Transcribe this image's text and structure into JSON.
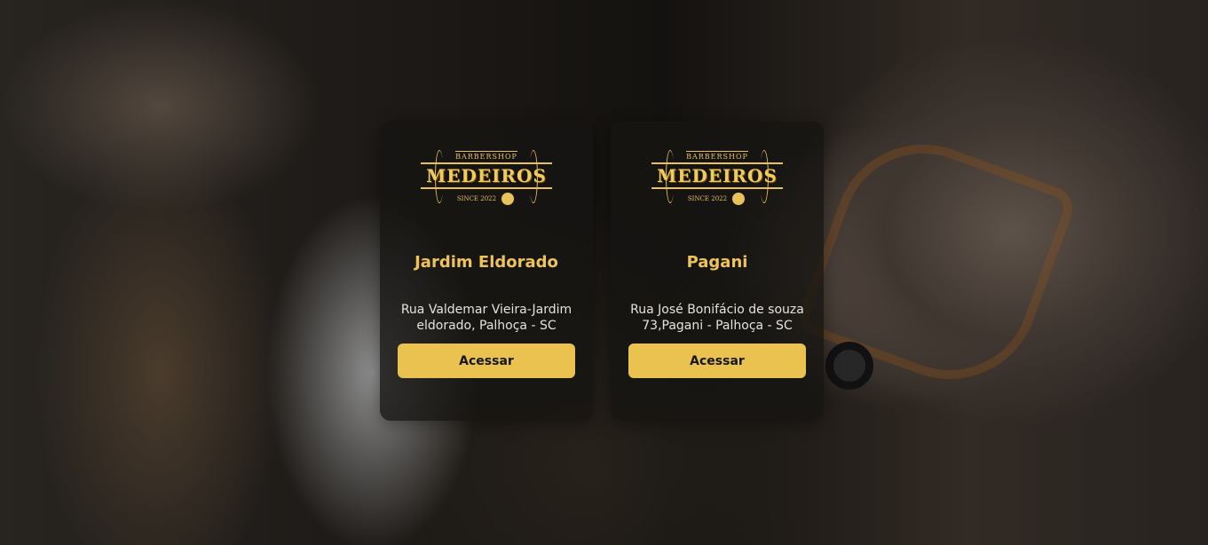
{
  "brand": {
    "logo_top": "BARBERSHOP",
    "logo_name": "MEDEIROS",
    "logo_since": "SINCE 2022"
  },
  "units": [
    {
      "name": "Jardim Eldorado",
      "address": "Rua Valdemar Vieira-Jardim eldorado, Palhoça - SC",
      "button_label": "Acessar"
    },
    {
      "name": "Pagani",
      "address": "Rua José Bonifácio de souza 73,Pagani - Palhoça - SC",
      "button_label": "Acessar"
    }
  ],
  "colors": {
    "accent": "#e9c24f",
    "card_bg": "#161412"
  }
}
